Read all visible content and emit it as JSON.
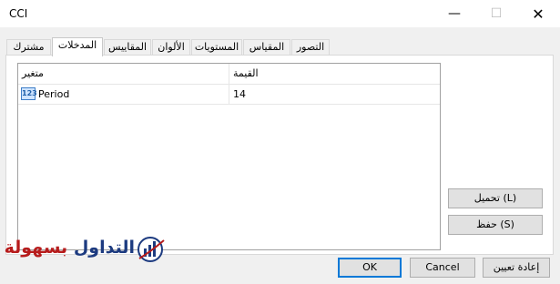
{
  "window": {
    "title": "CCI"
  },
  "tabs": [
    {
      "label": "مشترك"
    },
    {
      "label": "المدخلات",
      "active": true
    },
    {
      "label": "المقاييس"
    },
    {
      "label": "الألوان"
    },
    {
      "label": "المستويات"
    },
    {
      "label": "المقياس"
    },
    {
      "label": "التصور"
    }
  ],
  "grid": {
    "headers": {
      "variable": "متغير",
      "value": "القيمة"
    },
    "rows": [
      {
        "icon": "numeric-123-icon",
        "icon_text": "123",
        "name": "Period",
        "value": "14"
      }
    ]
  },
  "buttons": {
    "load": "تحميل (L)",
    "save": "حفظ (S)",
    "ok": "OK",
    "cancel": "Cancel",
    "reset": "إعادة تعيين"
  },
  "watermark": {
    "blue_text": "التداول",
    "red_text": "بسهولة"
  }
}
